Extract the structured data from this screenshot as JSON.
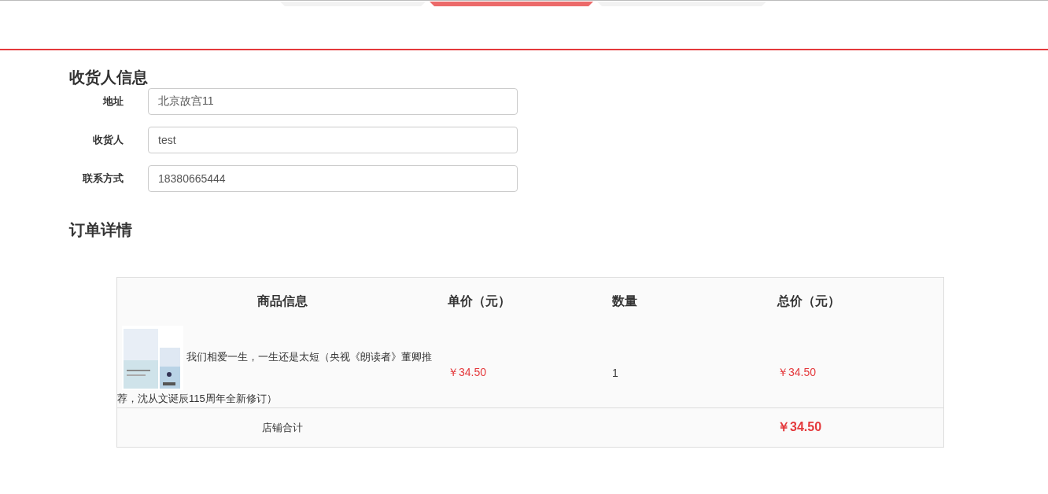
{
  "steps": [
    {
      "selected": false
    },
    {
      "selected": true
    },
    {
      "selected": false
    }
  ],
  "receiver": {
    "title": "收货人信息",
    "fields": [
      {
        "label": "地址",
        "value": "北京故宫11"
      },
      {
        "label": "收货人",
        "value": "test"
      },
      {
        "label": "联系方式",
        "value": "18380665444"
      }
    ]
  },
  "order": {
    "title": "订单详情",
    "columns": [
      "商品信息",
      "单价（元）",
      "数量",
      "总价（元）"
    ],
    "rows": [
      {
        "name": "我们相爱一生，一生还是太短（央视《朗读者》董卿推荐，沈从文诞辰115周年全新修订）",
        "price": "￥34.50",
        "quantity": "1",
        "total": "￥34.50"
      }
    ],
    "summary": {
      "label": "店铺合计",
      "total": "￥34.50"
    }
  }
}
